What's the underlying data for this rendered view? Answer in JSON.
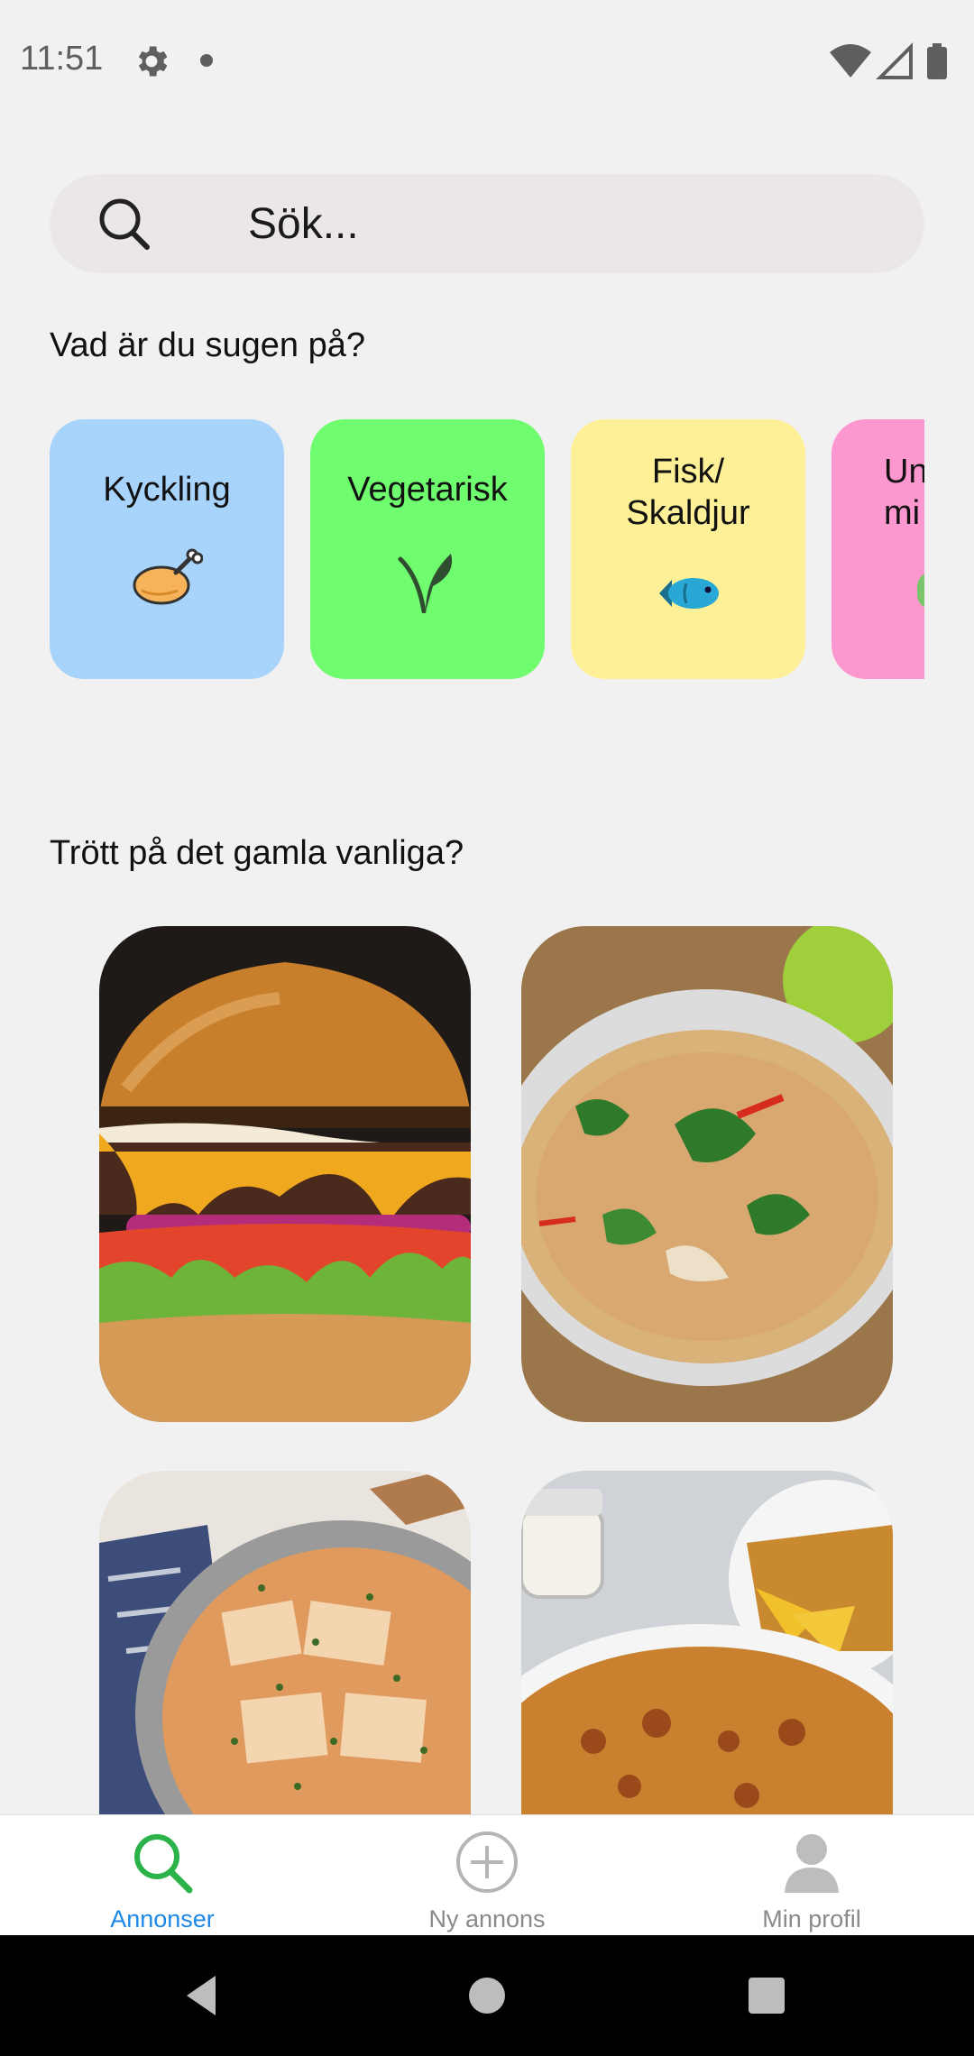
{
  "status_bar": {
    "time": "11:51"
  },
  "search": {
    "placeholder": "Sök..."
  },
  "categories_section": {
    "title": "Vad är du sugen på?",
    "items": [
      {
        "label": "Kyckling",
        "color": "#a8d4fb",
        "icon": "chicken-leg-icon"
      },
      {
        "label": "Vegetarisk",
        "color": "#6ffc6f",
        "icon": "leaf-sprout-icon"
      },
      {
        "label": "Fisk/\nSkaldjur",
        "color": "#fdf096",
        "icon": "fish-icon"
      },
      {
        "label": "Un\nmi",
        "color": "#fd97cf",
        "icon": "partial-icon"
      }
    ]
  },
  "recipes_section": {
    "title": "Trött på det gamla vanliga?",
    "items": [
      {
        "image": "burger"
      },
      {
        "image": "thai-soup"
      },
      {
        "image": "fish-tomato-pan"
      },
      {
        "image": "quiche-with-chips"
      }
    ]
  },
  "bottom_nav": {
    "items": [
      {
        "label": "Annonser",
        "icon": "search-icon",
        "active": true
      },
      {
        "label": "Ny annons",
        "icon": "add-circle-icon",
        "active": false
      },
      {
        "label": "Min profil",
        "icon": "person-icon",
        "active": false
      }
    ]
  },
  "colors": {
    "active": "#1e88e5",
    "active_icon": "#2bb34a",
    "inactive": "#8a8a8a"
  }
}
